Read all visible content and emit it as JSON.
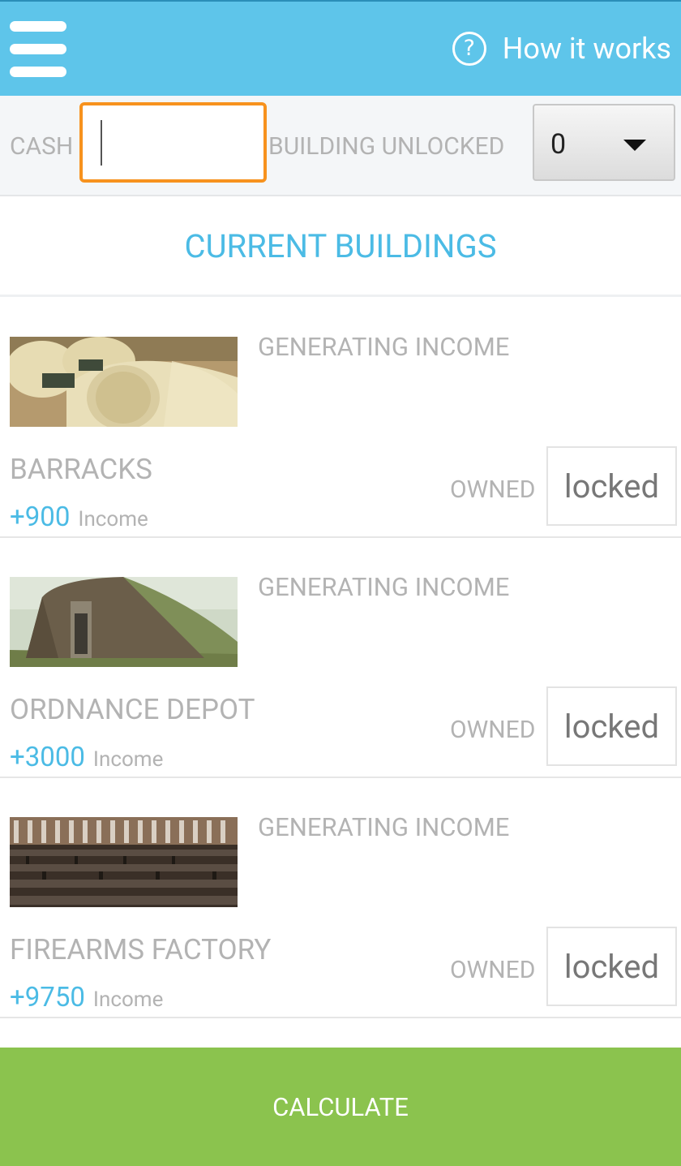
{
  "header": {
    "menu_icon": "hamburger-menu-icon",
    "help_icon": "question-circle-icon",
    "help_glyph": "?",
    "help_label": "How it works"
  },
  "filters": {
    "cash_label": "CASH",
    "cash_value": "",
    "building_unlocked_label": "BUILDING UNLOCKED",
    "building_unlocked_value": "0"
  },
  "section_title": "CURRENT BUILDINGS",
  "buildings": [
    {
      "status": "GENERATING INCOME",
      "name": "BARRACKS",
      "income_value": "+900",
      "income_word": "Income",
      "owned_label": "OWNED",
      "owned_value": "locked"
    },
    {
      "status": "GENERATING INCOME",
      "name": "ORDNANCE DEPOT",
      "income_value": "+3000",
      "income_word": "Income",
      "owned_label": "OWNED",
      "owned_value": "locked"
    },
    {
      "status": "GENERATING INCOME",
      "name": "FIREARMS FACTORY",
      "income_value": "+9750",
      "income_word": "Income",
      "owned_label": "OWNED",
      "owned_value": "locked"
    }
  ],
  "calculate_label": "CALCULATE",
  "colors": {
    "header_bg": "#5ec5ea",
    "accent_blue": "#4bbbe5",
    "input_focus": "#f7921e",
    "calculate_bg": "#8bc34e"
  }
}
